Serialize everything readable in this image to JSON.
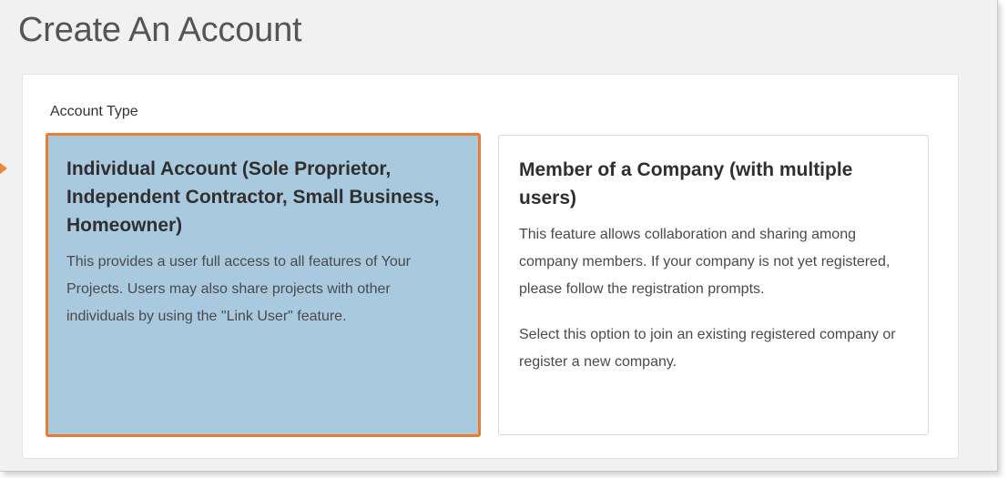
{
  "page": {
    "title": "Create An Account"
  },
  "form": {
    "section_label": "Account Type",
    "selected_option": "individual"
  },
  "options": {
    "individual": {
      "title": "Individual Account (Sole Proprietor, Independent Contractor, Small Business, Homeowner)",
      "description": "This provides a user full access to all features of Your Projects. Users may also share projects with other individuals by using the \"Link User\" feature."
    },
    "company": {
      "title": "Member of a Company (with multiple users)",
      "description": "This feature allows collaboration and sharing among company members. If your company is not yet registered, please follow the registration prompts.",
      "note": "Select this option to join an existing registered company or register a new company."
    }
  },
  "colors": {
    "selected_card_bg": "#a9c9df",
    "selected_border": "#e97d31",
    "pointer_arrow": "#e8883a",
    "page_bg": "#f1f1f1"
  },
  "icons": {
    "pointer": "arrow-right-pointer-icon"
  }
}
